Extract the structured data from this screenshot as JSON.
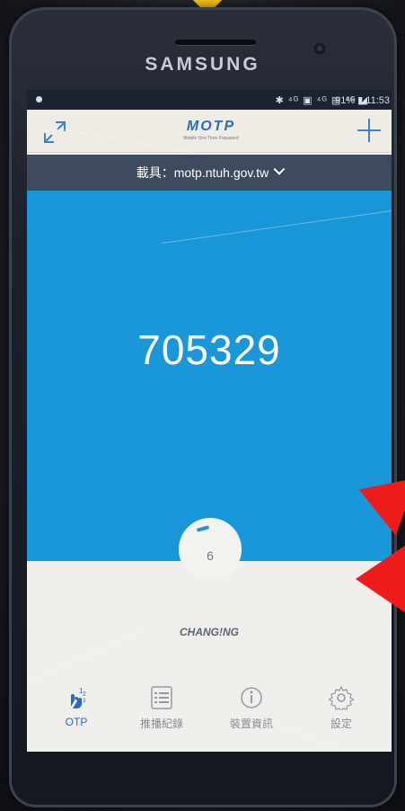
{
  "device": {
    "brand": "SAMSUNG"
  },
  "status_bar": {
    "icons": "✱ ⁴ᴳ ▣ ⁴ᴳ ▤ ⁴ᴳ ◢",
    "battery_time": "91% ▮ 11:53"
  },
  "app": {
    "logo": "MOTP",
    "logo_subtitle": "Mobile One Time Password"
  },
  "carrier": {
    "label": "載具：motp.ntuh.gov.tw"
  },
  "otp": {
    "code": "705329",
    "countdown": "6",
    "status_text": "CHANG!NG"
  },
  "tabs": [
    {
      "label": "OTP",
      "icon": "hand-tap-icon",
      "active": true
    },
    {
      "label": "推播紀錄",
      "icon": "list-icon",
      "active": false
    },
    {
      "label": "裝置資訊",
      "icon": "info-icon",
      "active": false
    },
    {
      "label": "設定",
      "icon": "gear-icon",
      "active": false
    }
  ],
  "colors": {
    "otp_background": "#1a97d9",
    "active_tab": "#2b6cb6",
    "annotation_arrows": "#ee1b1b"
  }
}
